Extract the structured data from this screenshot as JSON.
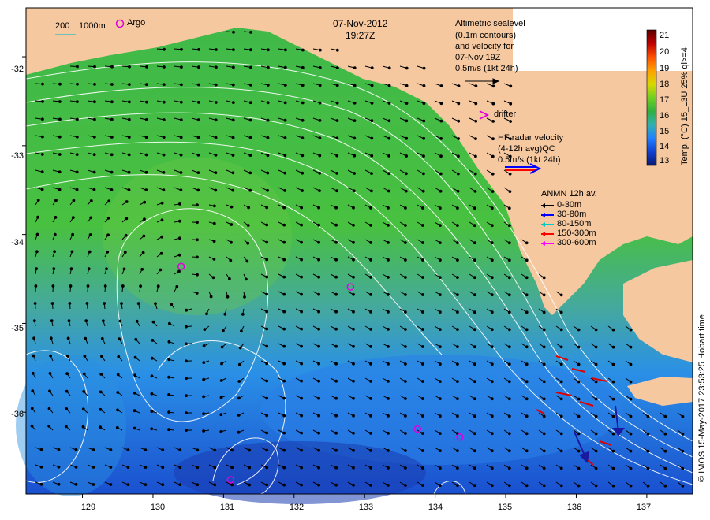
{
  "header": {
    "date": "07-Nov-2012",
    "time": "19:27Z"
  },
  "scale_legend": {
    "depth_label": "200",
    "depth_label_2": "1000m",
    "argo_label": "Argo"
  },
  "altimetry_note": {
    "line1": "Altimetric sealevel",
    "line2": "(0.1m contours)",
    "line3": "and velocity for",
    "line4": "07-Nov 19Z",
    "line5": "0.5m/s (1kt 24h)"
  },
  "drifter_label": "drifter",
  "hf_radar": {
    "line1": "HF radar velocity",
    "line2": "(4-12h avg)QC",
    "line3": "0.5m/s (1kt 24h)"
  },
  "anmn": {
    "title": "ANMN 12h av.",
    "items": [
      {
        "label": "0-30m",
        "color": "#000000"
      },
      {
        "label": "30-80m",
        "color": "#0000ff"
      },
      {
        "label": "80-150m",
        "color": "#00c8c8"
      },
      {
        "label": "150-300m",
        "color": "#ff0000"
      },
      {
        "label": "300-600m",
        "color": "#ff00ff"
      }
    ]
  },
  "colorbar": {
    "label": "Temp. (°C) 15_L3U 25% ql>=4",
    "ticks": [
      "21",
      "20",
      "19",
      "18",
      "17",
      "16",
      "15",
      "14",
      "13"
    ],
    "colors": [
      "#5a0000",
      "#b30000",
      "#ff4000",
      "#ff9900",
      "#e8d000",
      "#b0e000",
      "#60cc20",
      "#30b030",
      "#20a060",
      "#30b0c0",
      "#2080ff",
      "#1040d0",
      "#0a1a80"
    ]
  },
  "axes": {
    "y_ticks": [
      "-32",
      "-33",
      "-34",
      "-35",
      "-36"
    ],
    "x_ticks": [
      "129",
      "130",
      "131",
      "132",
      "133",
      "134",
      "135",
      "136",
      "137"
    ],
    "lat_range": [
      -36.92,
      -31.45
    ],
    "lon_range": [
      128.2,
      137.65
    ]
  },
  "credit": "© IMOS 15-May-2017 23:53:25 Hobart time",
  "argo_floats": [
    {
      "lon": 130.4,
      "lat": -34.36
    },
    {
      "lon": 132.8,
      "lat": -34.59
    },
    {
      "lon": 133.75,
      "lat": -36.19
    },
    {
      "lon": 134.35,
      "lat": -36.28
    },
    {
      "lon": 131.1,
      "lat": -36.76
    }
  ],
  "colors": {
    "land": "#f5c8a0",
    "ocean_mid": "#40b83c",
    "ocean_south": "#2a88e0",
    "argo": "#e000e0"
  }
}
